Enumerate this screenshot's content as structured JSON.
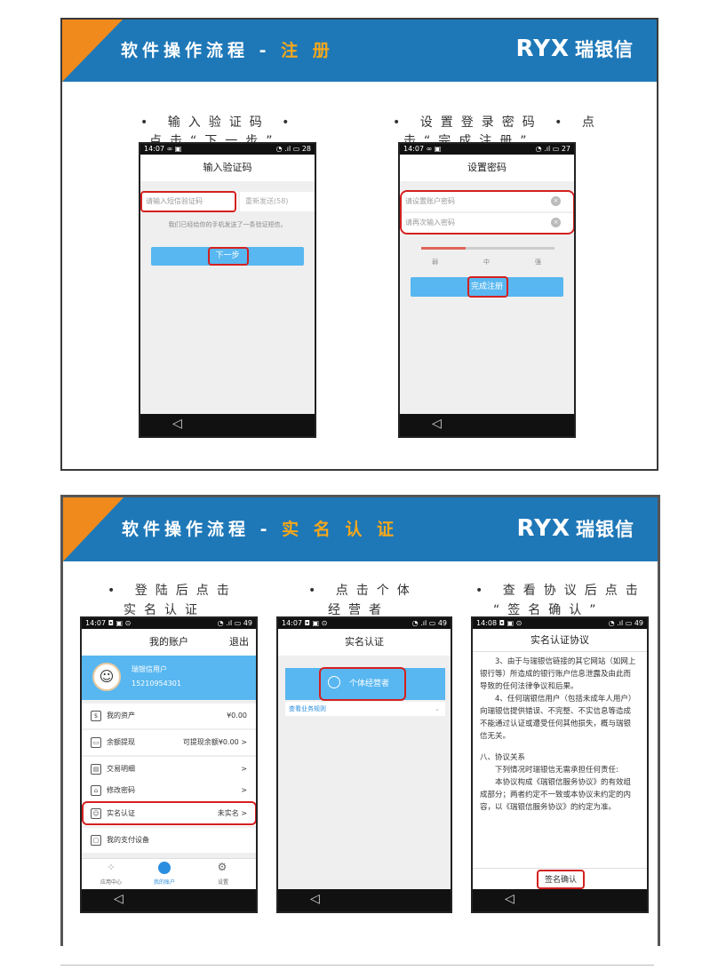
{
  "slide1": {
    "header": {
      "title_prefix": "软件操作流程 - ",
      "title_highlight": "注 册",
      "logo_mark": "RYX",
      "logo_name": "瑞银信"
    },
    "bullet_left_1": "• 输入验证码  •",
    "bullet_left_2": "点击“下一步”",
    "bullet_right_1": "• 设置登录密码 • 点",
    "bullet_right_2": "击“完成注册”",
    "phone1": {
      "status_time": "14:07 ∞ ▣",
      "status_right": "◔ .ıl ▭ 28",
      "title": "输入验证码",
      "code_placeholder": "请输入短信验证码",
      "resend": "重新发送(58)",
      "hint": "我们已经给你的手机发送了一条验证短信。",
      "next_button": "下一步"
    },
    "phone2": {
      "status_time": "14:07 ∞ ▣",
      "status_right": "◔ .ıl ▭ 27",
      "title": "设置密码",
      "pwd_placeholder": "请设置账户密码",
      "pwd2_placeholder": "请再次输入密码",
      "strength_weak": "弱",
      "strength_mid": "中",
      "strength_strong": "强",
      "finish_button": "完成注册"
    }
  },
  "slide2": {
    "header": {
      "title_prefix": "软件操作流程 - ",
      "title_highlight": "实 名 认 证",
      "logo_mark": "RYX",
      "logo_name": "瑞银信"
    },
    "bullet_1a": "• 登陆后点击",
    "bullet_1b": "实名认证",
    "bullet_2a": "• 点击个体",
    "bullet_2b": "经营者",
    "bullet_3a": "• 查看协议后点击",
    "bullet_3b": "“签名确认”",
    "phone3": {
      "status_time": "14:07 ◘ ▣ ⊙",
      "status_right": "◔ .ıl ▭ 49",
      "title": "我的账户",
      "logout": "退出",
      "user_name": "瑞银信用户",
      "user_phone": "15210954301",
      "rows": [
        {
          "icon": "$",
          "label": "我的资产",
          "value": "¥0.00"
        },
        {
          "icon": "▭",
          "label": "余额提现",
          "value": "可提现余额¥0.00 >"
        },
        {
          "icon": "▤",
          "label": "交易明细",
          "value": ">"
        },
        {
          "icon": "⌂",
          "label": "修改密码",
          "value": ">"
        },
        {
          "icon": "☺",
          "label": "实名认证",
          "value": "未实名 >"
        },
        {
          "icon": "▢",
          "label": "我的支付设备",
          "value": ""
        }
      ],
      "tabs": [
        "应用中心",
        "我的账户",
        "设置"
      ]
    },
    "phone4": {
      "status_time": "14:07 ◘ ▣ ⊙",
      "status_right": "◔ .ıl ▭ 49",
      "title": "实名认证",
      "option": "个体经营者",
      "link": "查看业务规则"
    },
    "phone5": {
      "status_time": "14:08 ◘ ▣ ⊙",
      "status_right": "◔ .ıl ▭ 49",
      "title": "实名认证协议",
      "p1": "3、由于与瑞银信链接的其它网站（如网上银行等）所造成的银行账户信息泄露及由此而导致的任何法律争议和后果。",
      "p2": "4、任何瑞银信用户（包括未成年人用户）向瑞银信提供错误、不完整、不实信息等造成不能通过认证或遭受任何其他损失，概与瑞银信无关。",
      "p3": "八、协议关系",
      "p4": "下列情况时瑞银信无需承担任何责任:",
      "p5": "本协议构成《瑞银信服务协议》的有效组成部分；两者约定不一致或本协议未约定的内容，以《瑞银信服务协议》的约定为准。",
      "sign_button": "签名确认"
    }
  },
  "colors": {
    "header_blue": "#1e78b8",
    "accent_orange": "#f08a1c",
    "highlight_red": "#d42020",
    "button_blue": "#58b7f0"
  }
}
